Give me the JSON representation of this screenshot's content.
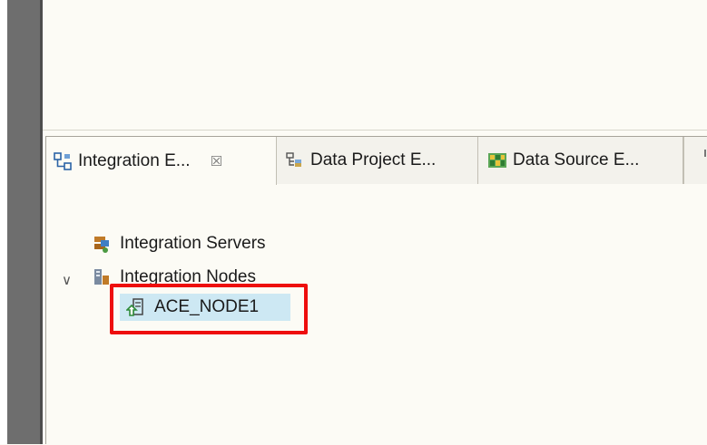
{
  "tabs": [
    {
      "label": "Integration E...",
      "icon": "integration-explorer-icon",
      "active": true,
      "closable": true
    },
    {
      "label": "Data Project E...",
      "icon": "data-project-icon",
      "active": false
    },
    {
      "label": "Data Source E...",
      "icon": "data-source-icon",
      "active": false
    }
  ],
  "tab_close_glyph": "☒",
  "tree": {
    "servers": {
      "label": "Integration Servers",
      "icon": "integration-servers-icon"
    },
    "nodes": {
      "label": "Integration Nodes",
      "icon": "integration-nodes-icon",
      "expanded": true
    },
    "node1": {
      "label": "ACE_NODE1",
      "icon": "integration-node-icon",
      "selected": true
    }
  },
  "twisty_glyph": "∨",
  "colors": {
    "highlight": "#ee0e0e",
    "selection": "#cde8f3",
    "background": "#fcfbf5"
  }
}
